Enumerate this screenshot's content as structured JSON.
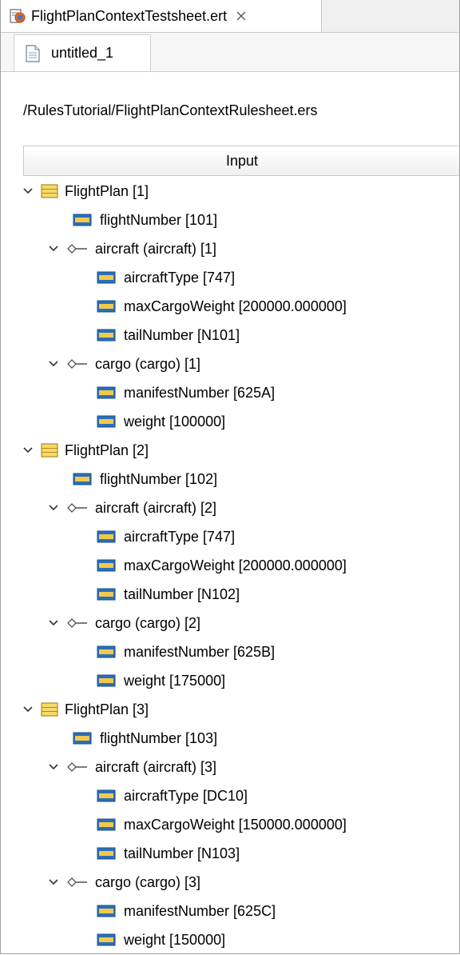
{
  "editor_tab": {
    "title": "FlightPlanContextTestsheet.ert"
  },
  "inner_tab": {
    "label": "untitled_1"
  },
  "path": "/RulesTutorial/FlightPlanContextRulesheet.ers",
  "column_header": "Input",
  "tree": {
    "fp1": {
      "label": "FlightPlan [1]",
      "flightNumber": "flightNumber [101]",
      "aircraft": {
        "label": "aircraft (aircraft) [1]",
        "aircraftType": "aircraftType [747]",
        "maxCargoWeight": "maxCargoWeight [200000.000000]",
        "tailNumber": "tailNumber [N101]"
      },
      "cargo": {
        "label": "cargo (cargo) [1]",
        "manifestNumber": "manifestNumber [625A]",
        "weight": "weight [100000]"
      }
    },
    "fp2": {
      "label": "FlightPlan [2]",
      "flightNumber": "flightNumber [102]",
      "aircraft": {
        "label": "aircraft (aircraft) [2]",
        "aircraftType": "aircraftType [747]",
        "maxCargoWeight": "maxCargoWeight [200000.000000]",
        "tailNumber": "tailNumber [N102]"
      },
      "cargo": {
        "label": "cargo (cargo) [2]",
        "manifestNumber": "manifestNumber [625B]",
        "weight": "weight [175000]"
      }
    },
    "fp3": {
      "label": "FlightPlan [3]",
      "flightNumber": "flightNumber [103]",
      "aircraft": {
        "label": "aircraft (aircraft) [3]",
        "aircraftType": "aircraftType [DC10]",
        "maxCargoWeight": "maxCargoWeight [150000.000000]",
        "tailNumber": "tailNumber [N103]"
      },
      "cargo": {
        "label": "cargo (cargo) [3]",
        "manifestNumber": "manifestNumber [625C]",
        "weight": "weight [150000]"
      }
    }
  },
  "icons": {
    "editor_tab": "testsheet-icon",
    "close": "close-icon",
    "file": "file-icon",
    "entity": "entity-icon",
    "association": "association-icon",
    "attribute": "attribute-icon",
    "expand": "chevron-down-icon"
  },
  "colors": {
    "entity_fill": "#f5d96b",
    "attribute_fill": "#2b6fb8",
    "attribute_bar": "#f2c94c",
    "header_border": "#c9c9c9"
  }
}
